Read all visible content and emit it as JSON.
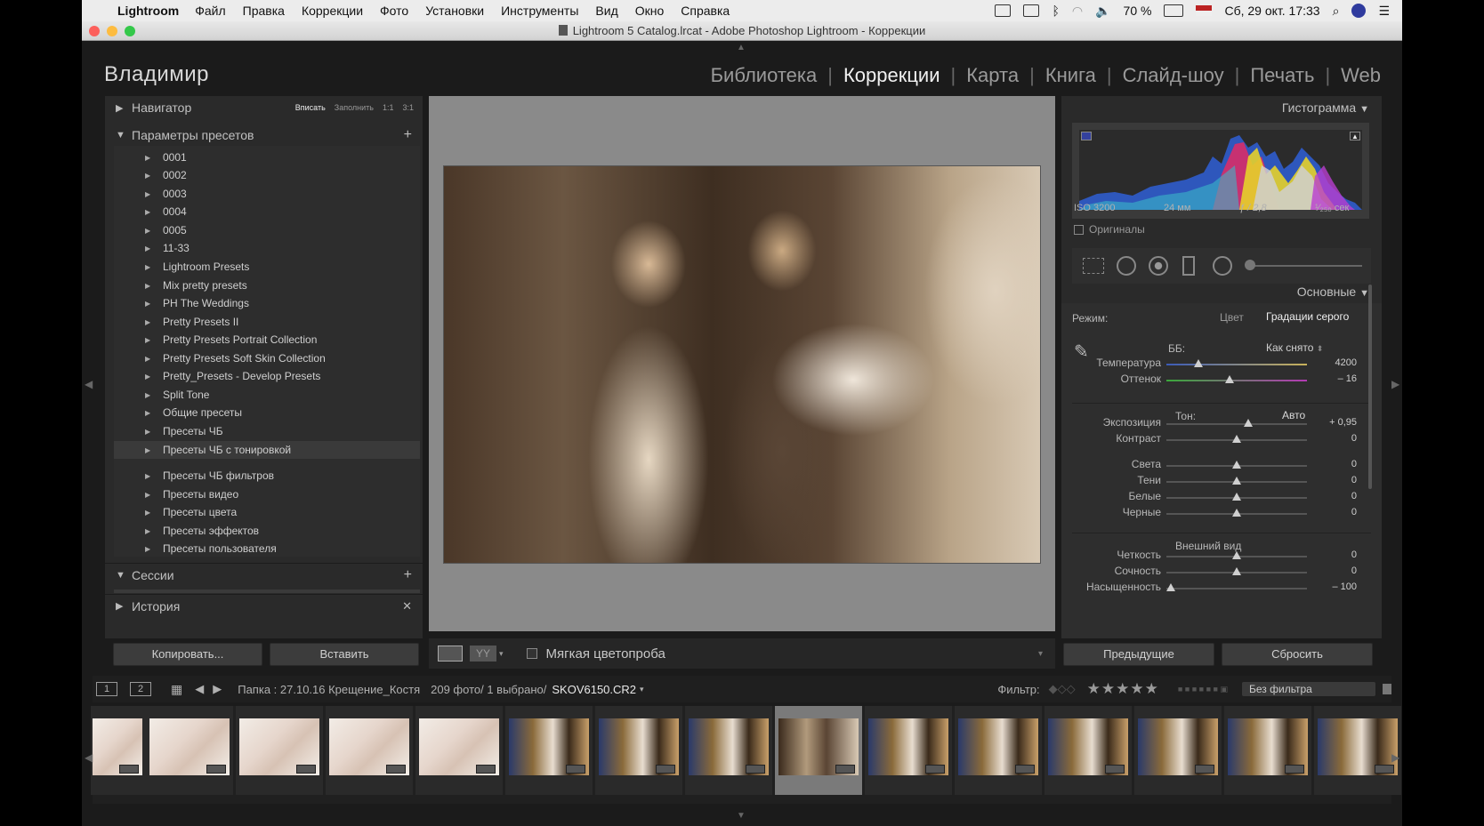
{
  "menubar": {
    "app": "Lightroom",
    "items": [
      "Файл",
      "Правка",
      "Коррекции",
      "Фото",
      "Установки",
      "Инструменты",
      "Вид",
      "Окно",
      "Справка"
    ],
    "battery": "70 %",
    "datetime": "Сб, 29 окт. 17:33"
  },
  "window": {
    "title": "Lightroom 5 Catalog.lrcat - Adobe Photoshop Lightroom - Коррекции"
  },
  "identity": "Владимир",
  "modules": [
    "Библиотека",
    "Коррекции",
    "Карта",
    "Книга",
    "Слайд-шоу",
    "Печать",
    "Web"
  ],
  "active_module": "Коррекции",
  "navigator": {
    "label": "Навигатор",
    "zoom_options": [
      "Вписать",
      "Заполнить",
      "1:1",
      "3:1"
    ]
  },
  "presets": {
    "label": "Параметры пресетов",
    "items": [
      "0001",
      "0002",
      "0003",
      "0004",
      "0005",
      "11-33",
      "Lightroom Presets",
      "Mix pretty presets",
      "PH The Weddings",
      "Pretty Presets II",
      "Pretty Presets Portrait Collection",
      "Pretty Presets Soft Skin Collection",
      "Pretty_Presets - Develop Presets",
      "Split Tone",
      "Общие пресеты",
      "Пресеты ЧБ",
      "Пресеты ЧБ с тонировкой",
      "Пресеты ЧБ фильтров",
      "Пресеты видео",
      "Пресеты цвета",
      "Пресеты эффектов",
      "Пресеты пользователя"
    ],
    "highlighted": "Пресеты ЧБ с тонировкой"
  },
  "sessions": {
    "label": "Сессии"
  },
  "history": {
    "label": "История"
  },
  "left_buttons": {
    "copy": "Копировать...",
    "paste": "Вставить"
  },
  "toolbar": {
    "soft_proof": "Мягкая цветопроба"
  },
  "histogram": {
    "label": "Гистограмма",
    "iso": "ISO 3200",
    "focal": "24 мм",
    "aperture": "ƒ / 2,8",
    "shutter": "¹⁄₂₅₀ сек",
    "originals": "Оригиналы"
  },
  "basic": {
    "label": "Основные",
    "mode_label": "Режим:",
    "mode_color": "Цвет",
    "mode_bw": "Градации серого",
    "wb_label": "ББ:",
    "wb_value": "Как снято",
    "tone_label": "Тон:",
    "tone_auto": "Авто",
    "presence_label": "Внешний вид",
    "sliders": [
      {
        "name": "Температура",
        "value": "4200",
        "pos": 0.23
      },
      {
        "name": "Оттенок",
        "value": "– 16",
        "pos": 0.45
      },
      {
        "name": "Экспозиция",
        "value": "+ 0,95",
        "pos": 0.58
      },
      {
        "name": "Контраст",
        "value": "0",
        "pos": 0.5
      },
      {
        "name": "Света",
        "value": "0",
        "pos": 0.5
      },
      {
        "name": "Тени",
        "value": "0",
        "pos": 0.5
      },
      {
        "name": "Белые",
        "value": "0",
        "pos": 0.5
      },
      {
        "name": "Черные",
        "value": "0",
        "pos": 0.5
      },
      {
        "name": "Четкость",
        "value": "0",
        "pos": 0.5
      },
      {
        "name": "Сочность",
        "value": "0",
        "pos": 0.5
      },
      {
        "name": "Насыщенность",
        "value": "– 100",
        "pos": 0.03
      }
    ]
  },
  "right_buttons": {
    "previous": "Предыдущие",
    "reset": "Сбросить"
  },
  "filmstrip_bar": {
    "pages": [
      "1",
      "2"
    ],
    "folder": "Папка : 27.10.16 Крещение_Костя",
    "count": "209 фото/ 1 выбрано/",
    "file": "SKOV6150.CR2",
    "filter_label": "Фильтр:",
    "filter_value": "Без фильтра"
  },
  "thumbs": [
    "baby",
    "baby",
    "baby",
    "baby",
    "baby",
    "church",
    "church",
    "church",
    "sepia",
    "church",
    "church",
    "church",
    "church",
    "church",
    "church"
  ],
  "selected_thumb": 8
}
